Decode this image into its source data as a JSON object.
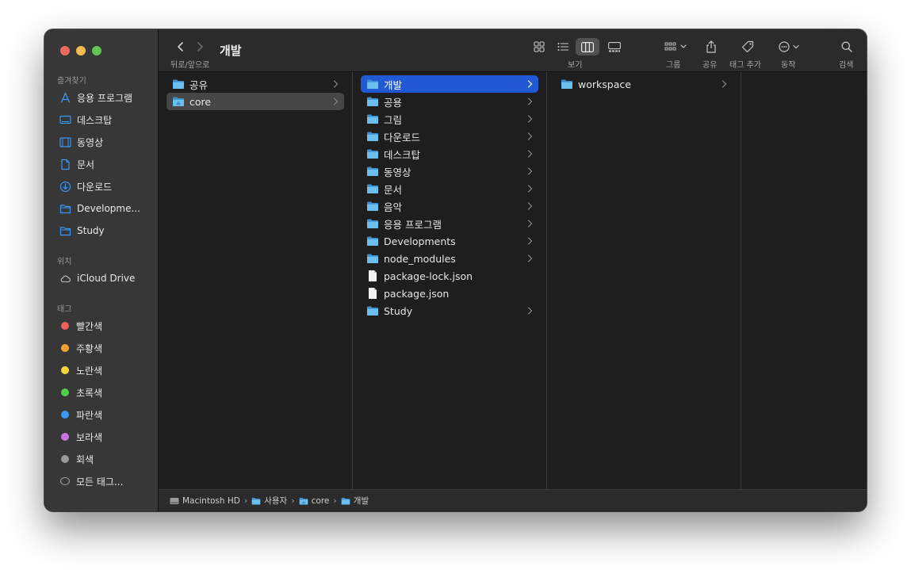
{
  "window": {
    "title": "개발"
  },
  "toolbar": {
    "nav_label": "뒤로/앞으로",
    "view_label": "보기",
    "group_label": "그룹",
    "share_label": "공유",
    "tag_label": "태그 추가",
    "action_label": "동작",
    "search_label": "검색"
  },
  "sidebar": {
    "favorites_header": "즐겨찾기",
    "favorites": [
      {
        "label": "응용 프로그램",
        "icon": "applications-icon"
      },
      {
        "label": "데스크탑",
        "icon": "desktop-icon"
      },
      {
        "label": "동영상",
        "icon": "movies-icon"
      },
      {
        "label": "문서",
        "icon": "document-icon"
      },
      {
        "label": "다운로드",
        "icon": "download-icon"
      },
      {
        "label": "Developme...",
        "icon": "folder-icon"
      },
      {
        "label": "Study",
        "icon": "folder-icon"
      }
    ],
    "locations_header": "위치",
    "locations": [
      {
        "label": "iCloud Drive",
        "icon": "cloud-icon"
      }
    ],
    "tags_header": "태그",
    "tags": [
      {
        "label": "빨간색",
        "color": "#ec5f5a"
      },
      {
        "label": "주황색",
        "color": "#f5a030"
      },
      {
        "label": "노란색",
        "color": "#f7d53c"
      },
      {
        "label": "초록색",
        "color": "#4fcf47"
      },
      {
        "label": "파란색",
        "color": "#3b97f0"
      },
      {
        "label": "보라색",
        "color": "#cb72e0"
      },
      {
        "label": "회색",
        "color": "#9a9a9a"
      },
      {
        "label": "모든 태그...",
        "color": ""
      }
    ]
  },
  "columns": [
    {
      "items": [
        {
          "label": "공유",
          "type": "folder",
          "chevron": true,
          "state": "none"
        },
        {
          "label": "core",
          "type": "home-folder",
          "chevron": true,
          "state": "inactive"
        }
      ]
    },
    {
      "items": [
        {
          "label": "개발",
          "type": "folder",
          "chevron": true,
          "state": "active"
        },
        {
          "label": "공용",
          "type": "folder",
          "chevron": true,
          "state": "none"
        },
        {
          "label": "그림",
          "type": "folder",
          "chevron": true,
          "state": "none"
        },
        {
          "label": "다운로드",
          "type": "folder",
          "chevron": true,
          "state": "none"
        },
        {
          "label": "데스크탑",
          "type": "folder",
          "chevron": true,
          "state": "none"
        },
        {
          "label": "동영상",
          "type": "folder",
          "chevron": true,
          "state": "none"
        },
        {
          "label": "문서",
          "type": "folder",
          "chevron": true,
          "state": "none"
        },
        {
          "label": "음악",
          "type": "folder",
          "chevron": true,
          "state": "none"
        },
        {
          "label": "응용 프로그램",
          "type": "folder",
          "chevron": true,
          "state": "none"
        },
        {
          "label": "Developments",
          "type": "folder",
          "chevron": true,
          "state": "none"
        },
        {
          "label": "node_modules",
          "type": "folder",
          "chevron": true,
          "state": "none"
        },
        {
          "label": "package-lock.json",
          "type": "file",
          "chevron": false,
          "state": "none"
        },
        {
          "label": "package.json",
          "type": "file",
          "chevron": false,
          "state": "none"
        },
        {
          "label": "Study",
          "type": "folder",
          "chevron": true,
          "state": "none"
        }
      ]
    },
    {
      "items": [
        {
          "label": "workspace",
          "type": "folder",
          "chevron": true,
          "state": "none"
        }
      ]
    },
    {
      "items": []
    }
  ],
  "pathbar": [
    {
      "label": "Macintosh HD",
      "icon": "disk-icon"
    },
    {
      "label": "사용자",
      "icon": "folder-icon"
    },
    {
      "label": "core",
      "icon": "home-folder-icon"
    },
    {
      "label": "개발",
      "icon": "folder-icon"
    }
  ],
  "colors": {
    "selection": "#2159d4",
    "folder": "#5ab1ea",
    "accent": "#3b97f0"
  }
}
